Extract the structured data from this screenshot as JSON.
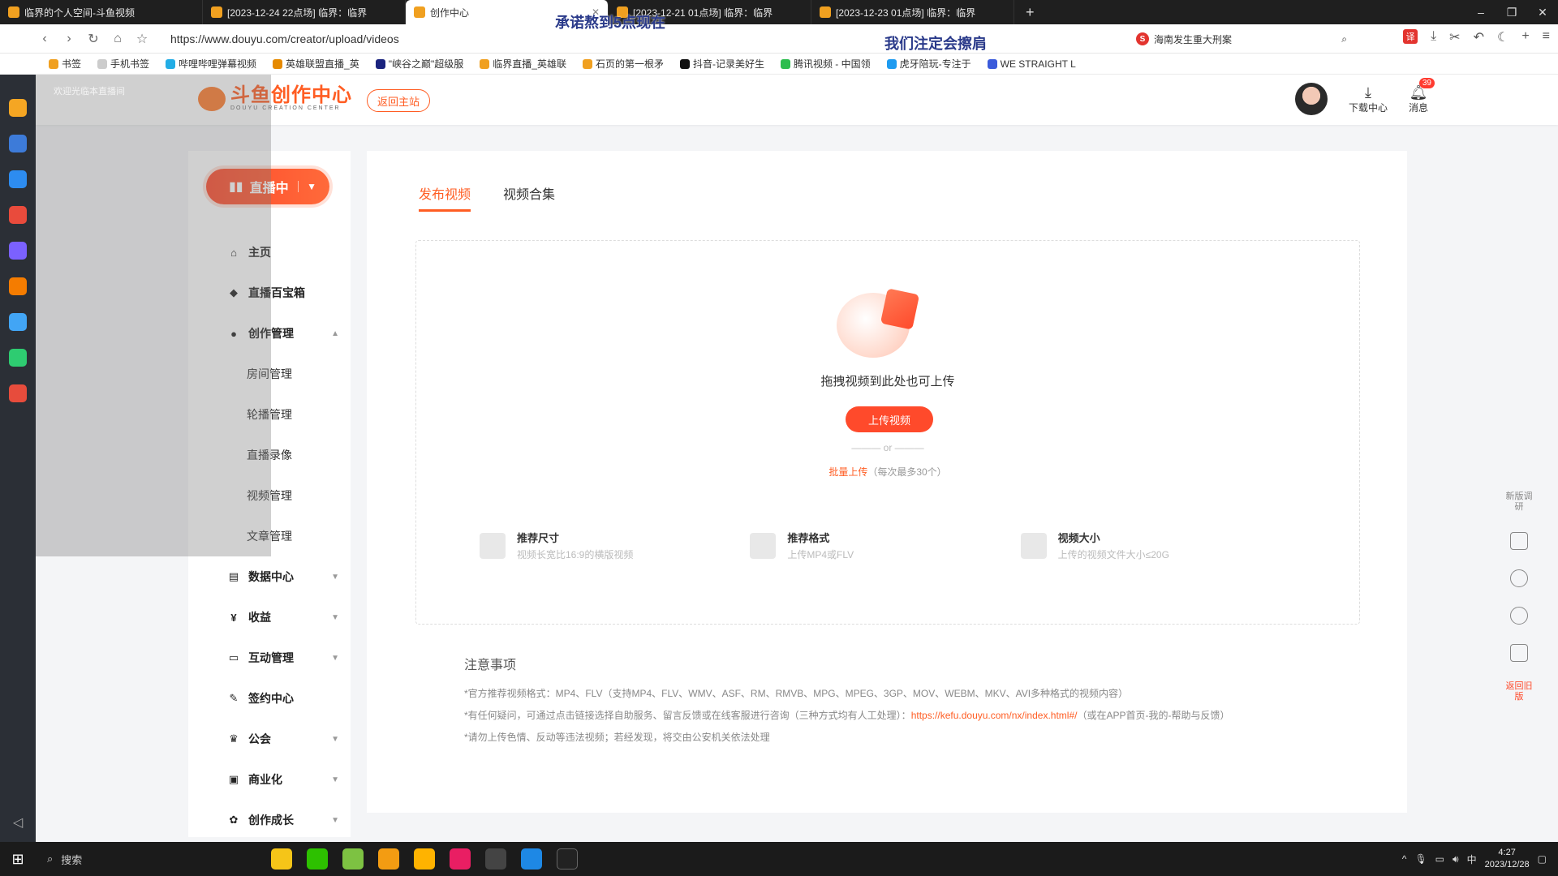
{
  "browser": {
    "tabs": [
      {
        "title": "临界的个人空间-斗鱼视频"
      },
      {
        "title": "[2023-12-24 22点场] 临界：临界"
      },
      {
        "title": "创作中心",
        "active": true
      },
      {
        "title": "[2023-12-21 01点场] 临界：临界"
      },
      {
        "title": "[2023-12-23 01点场] 临界：临界"
      }
    ],
    "url": "https://www.douyu.com/creator/upload/videos",
    "search_text": "海南发生重大刑案",
    "bookmarks": [
      "书签",
      "手机书签",
      "哔哩哔哩弹幕视频",
      "英雄联盟直播_英",
      "\"峡谷之巅\"超级服",
      "临界直播_英雄联",
      "石页的第一根矛",
      "抖音-记录美好生",
      "腾讯视频 - 中国领",
      "虎牙陪玩-专注于",
      "WE STRAIGHT L"
    ]
  },
  "header": {
    "logo_text": "斗鱼创作中心",
    "logo_sub": "DOUYU CREATION CENTER",
    "back_button": "返回主站",
    "download_label": "下载中心",
    "messages_label": "消息",
    "messages_badge": "39"
  },
  "leftnav": {
    "live_button": "直播中",
    "items": [
      {
        "label": "主页",
        "icon": "home-icon"
      },
      {
        "label": "直播百宝箱",
        "icon": "box-icon"
      },
      {
        "label": "创作管理",
        "icon": "bulb-icon",
        "expanded": true
      },
      {
        "label": "房间管理",
        "sub": true
      },
      {
        "label": "轮播管理",
        "sub": true
      },
      {
        "label": "直播录像",
        "sub": true
      },
      {
        "label": "视频管理",
        "sub": true
      },
      {
        "label": "文章管理",
        "sub": true
      },
      {
        "label": "数据中心",
        "icon": "chart-icon"
      },
      {
        "label": "收益",
        "icon": "money-icon"
      },
      {
        "label": "互动管理",
        "icon": "chat-icon"
      },
      {
        "label": "签约中心",
        "icon": "pen-icon"
      },
      {
        "label": "公会",
        "icon": "guild-icon"
      },
      {
        "label": "商业化",
        "icon": "briefcase-icon"
      },
      {
        "label": "创作成长",
        "icon": "sprout-icon"
      }
    ]
  },
  "main": {
    "tabs": [
      "发布视频",
      "视频合集"
    ],
    "drag_text": "拖拽视频到此处也可上传",
    "upload_button": "上传视频",
    "or_text": "or",
    "batch_link": "批量上传",
    "batch_note": "（每次最多30个）",
    "specs": [
      {
        "title": "推荐尺寸",
        "desc": "视频长宽比16:9的横版视频",
        "icon": "image-icon"
      },
      {
        "title": "推荐格式",
        "desc": "上传MP4或FLV",
        "icon": "video-icon"
      },
      {
        "title": "视频大小",
        "desc": "上传的视频文件大小≤20G",
        "icon": "gb-icon"
      }
    ],
    "notes_title": "注意事项",
    "note1": "*官方推荐视频格式：MP4、FLV（支持MP4、FLV、WMV、ASF、RM、RMVB、MPG、MPEG、3GP、MOV、WEBM、MKV、AVI多种格式的视频内容）",
    "note2_pre": "*有任何疑问，可通过点击链接选择自助服务、留言反馈或在线客服进行咨询（三种方式均有人工处理）：",
    "note2_link": "https://kefu.douyu.com/nx/index.html#/",
    "note2_post": "（或在APP首页-我的-帮助与反馈）",
    "note3": "*请勿上传色情、反动等违法视频；若经发现，将交由公安机关依法处理"
  },
  "right_tools": {
    "new_version": "新版调研",
    "back_old": "返回旧版"
  },
  "overlay": {
    "title1": "承诺熬到5点现在",
    "title2": "我们注定会擦肩",
    "welcome": "欢迎光临本直播间"
  },
  "taskbar": {
    "search": "搜索",
    "time": "4:27",
    "date": "2023/12/28"
  }
}
